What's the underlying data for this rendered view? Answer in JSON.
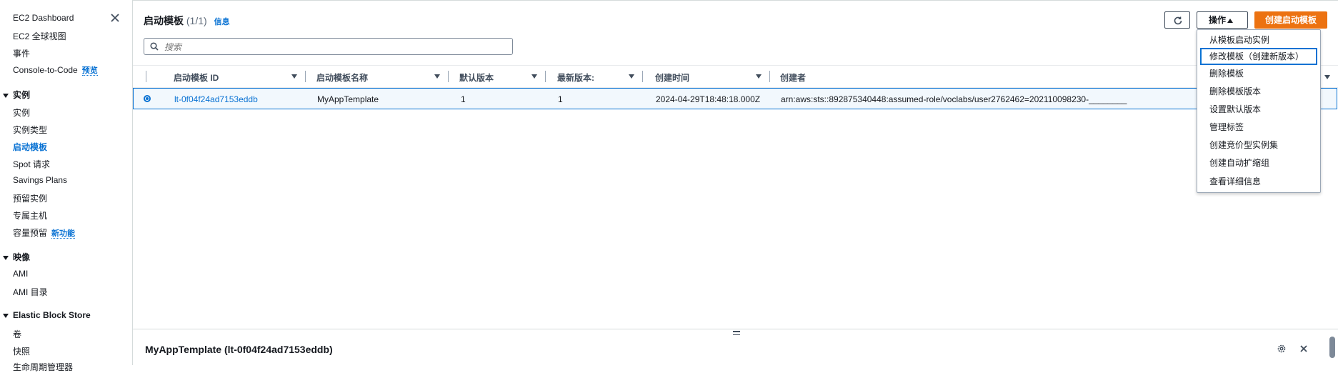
{
  "sidebar": {
    "top_items": [
      {
        "label": "EC2 Dashboard"
      },
      {
        "label": "EC2 全球视图"
      },
      {
        "label": "事件"
      },
      {
        "label": "Console-to-Code",
        "badge": "预览"
      }
    ],
    "sections": [
      {
        "title": "实例",
        "items": [
          {
            "label": "实例"
          },
          {
            "label": "实例类型"
          },
          {
            "label": "启动模板",
            "active": true
          },
          {
            "label": "Spot 请求"
          },
          {
            "label": "Savings Plans"
          },
          {
            "label": "预留实例"
          },
          {
            "label": "专属主机"
          },
          {
            "label": "容量预留",
            "badge": "新功能"
          }
        ]
      },
      {
        "title": "映像",
        "items": [
          {
            "label": "AMI"
          },
          {
            "label": "AMI 目录"
          }
        ]
      },
      {
        "title": "Elastic Block Store",
        "items": [
          {
            "label": "卷"
          },
          {
            "label": "快照"
          },
          {
            "label": "生命周期管理器"
          }
        ]
      }
    ]
  },
  "header": {
    "title": "启动模板",
    "count": "(1/1)",
    "info": "信息",
    "actions_label": "操作",
    "create_label": "创建启动模板"
  },
  "search": {
    "placeholder": "搜索"
  },
  "table": {
    "columns": [
      "启动模板 ID",
      "启动模板名称",
      "默认版本",
      "最新版本:",
      "创建时间",
      "创建者"
    ],
    "rows": [
      {
        "id": "lt-0f04f24ad7153eddb",
        "name": "MyAppTemplate",
        "default_version": "1",
        "latest_version": "1",
        "created": "2024-04-29T18:48:18.000Z",
        "creator": "arn:aws:sts::892875340448:assumed-role/voclabs/user2762462=202110098230-________"
      }
    ]
  },
  "actions_menu": {
    "items": [
      "从模板启动实例",
      "修改模板（创建新版本）",
      "删除模板",
      "删除模板版本",
      "设置默认版本",
      "管理标签",
      "创建竞价型实例集",
      "创建自动扩缩组",
      "查看详细信息"
    ],
    "selected_index": 1
  },
  "split_panel": {
    "title": "MyAppTemplate (lt-0f04f24ad7153eddb)"
  }
}
